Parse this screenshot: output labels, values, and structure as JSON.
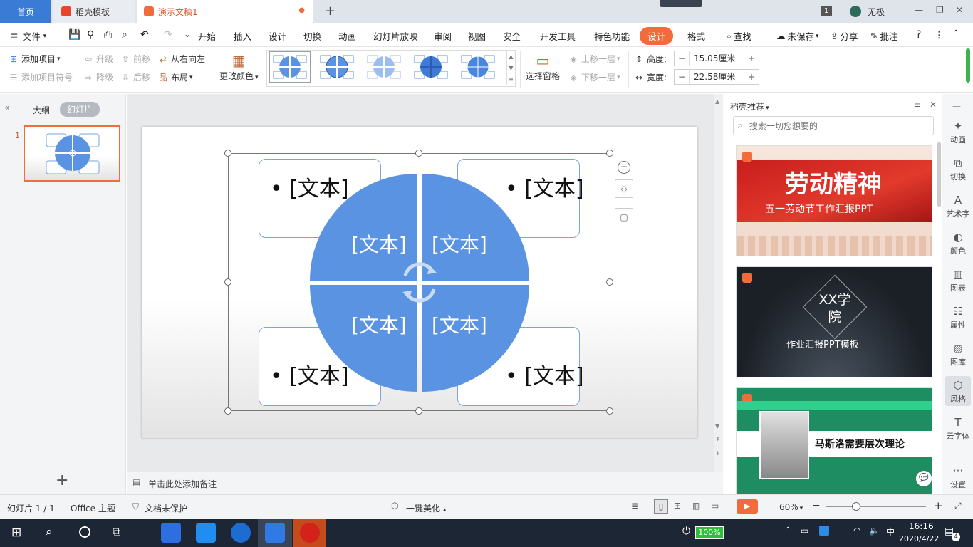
{
  "tabs": {
    "home": "首页",
    "docer": "稻壳模板",
    "doc": "演示文稿1",
    "add": "+"
  },
  "window": {
    "badge": "1",
    "user": "无极",
    "min": "—",
    "restore": "❐",
    "close": "✕"
  },
  "menu": {
    "file": "文件",
    "items": [
      "开始",
      "插入",
      "设计",
      "切换",
      "动画",
      "幻灯片放映",
      "审阅",
      "视图",
      "安全",
      "开发工具",
      "特色功能"
    ],
    "design_active": "设计",
    "format": "格式",
    "search": "查找",
    "unsaved": "未保存",
    "share": "分享",
    "annotate": "批注",
    "help": "?"
  },
  "ribbon": {
    "add_item": "添加项目",
    "add_bullet": "添加项目符号",
    "promote": "升级",
    "demote": "降级",
    "forward": "前移",
    "backward": "后移",
    "rtl": "从右向左",
    "layout": "布局",
    "change_color": "更改颜色",
    "select_pane": "选择窗格",
    "bring_forward": "上移一层",
    "send_backward": "下移一层",
    "height_label": "高度:",
    "height_value": "15.05厘米",
    "width_label": "宽度:",
    "width_value": "22.58厘米",
    "minus": "−",
    "plus": "+"
  },
  "left_panel": {
    "outline": "大纲",
    "slides": "幻灯片",
    "slide_num": "1",
    "add": "+"
  },
  "slide": {
    "card_text": "• [文本]",
    "quad_text": "[文本]"
  },
  "notes": {
    "placeholder": "单击此处添加备注"
  },
  "right_panel": {
    "title": "稻壳推荐",
    "search_placeholder": "搜索一切您想要的",
    "templates": [
      {
        "title": "劳动精神",
        "subtitle": "五一劳动节工作汇报PPT"
      },
      {
        "title": "XX学院",
        "subtitle": "作业汇报PPT模板"
      },
      {
        "title": "马斯洛需要层次理论",
        "subtitle": ""
      }
    ]
  },
  "rail": [
    "动画",
    "切换",
    "艺术字",
    "颜色",
    "图表",
    "属性",
    "图库",
    "风格",
    "云字体",
    "设置"
  ],
  "status": {
    "slide_info": "幻灯片 1 / 1",
    "theme": "Office 主题",
    "protect": "文档未保护",
    "beautify": "一键美化",
    "zoom": "60%",
    "zoom_minus": "−",
    "zoom_plus": "+"
  },
  "taskbar": {
    "battery": "100%",
    "time": "16:16",
    "date": "2020/4/22",
    "notif": "4"
  },
  "colors": {
    "accent": "#3a7bd5",
    "design_tab": "#f26b3a",
    "shape_blue": "#5b93e3",
    "card_border": "#7ba4de"
  }
}
